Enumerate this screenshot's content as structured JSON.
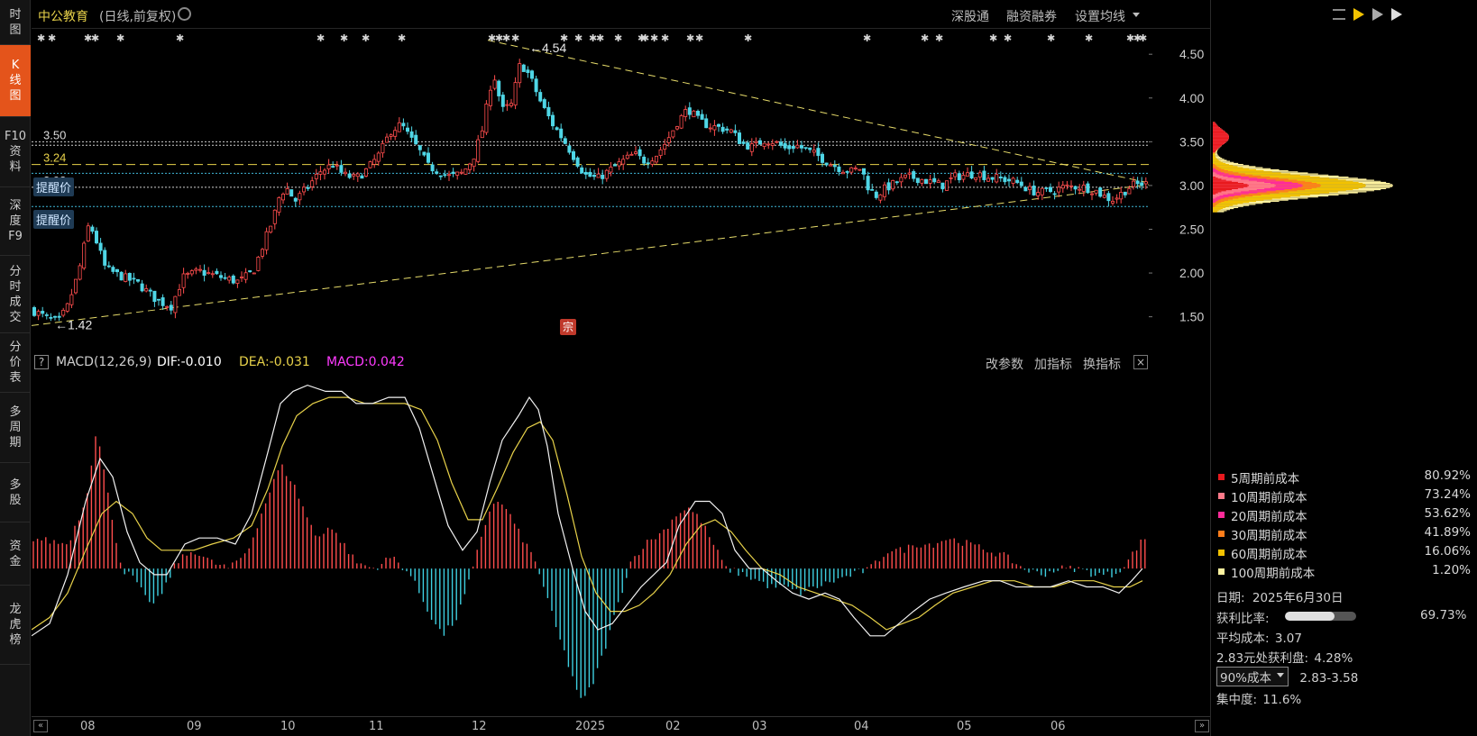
{
  "sidebar": {
    "items": [
      {
        "label": "时\n图",
        "active": false
      },
      {
        "label": "K\n线\n图",
        "active": true
      },
      {
        "label": "F10\n资\n料",
        "active": false
      },
      {
        "label": "深\n度\nF9",
        "active": false
      },
      {
        "label": "分\n时\n成\n交",
        "active": false
      },
      {
        "label": "分\n价\n表",
        "active": false
      },
      {
        "label": "多\n周\n期",
        "active": false
      },
      {
        "label": "多\n股",
        "active": false
      },
      {
        "label": "资\n金",
        "active": false
      },
      {
        "label": "龙\n虎\n榜",
        "active": false
      }
    ]
  },
  "header": {
    "stock_name": "中公教育",
    "chart_mode": "(日线,前复权)",
    "links": [
      "深股通",
      "融资融券",
      "设置均线"
    ]
  },
  "price_chart": {
    "y_ticks": [
      "4.50",
      "4.00",
      "3.50",
      "3.00",
      "2.50",
      "2.00",
      "1.50"
    ],
    "y_tick_values": [
      4.5,
      4.0,
      3.5,
      3.0,
      2.5,
      2.0,
      1.5
    ],
    "y_range": [
      1.28,
      4.78
    ],
    "high_label": "4.54",
    "low_label": "1.42",
    "level_labels": [
      "3.50",
      "3.24",
      "2.98"
    ],
    "reminder_labels": [
      "提醒价",
      "提醒价"
    ],
    "badge": "宗",
    "colors": {
      "up": "#ff4d4d",
      "down": "#4fd6e6",
      "trend": "#e6db6a",
      "level_white": "#cfcfcf",
      "level_cyan": "#3fb7d8",
      "level_yellow": "#e8d24a"
    }
  },
  "macd": {
    "title": "MACD(12,26,9)",
    "dif_label": "DIF:-0.010",
    "dea_label": "DEA:-0.031",
    "macd_label": "MACD:0.042",
    "links": [
      "改参数",
      "加指标",
      "换指标"
    ],
    "y_ticks": [
      "0.28",
      "0.22",
      "0.16",
      "0.10",
      "0.05",
      "-0.01",
      "-0.07",
      "-0.12",
      "-0.18",
      "-0.24"
    ],
    "y_tick_values": [
      0.28,
      0.22,
      0.16,
      0.1,
      0.05,
      -0.01,
      -0.07,
      -0.12,
      -0.18,
      -0.24
    ],
    "y_range": [
      -0.25,
      0.31
    ]
  },
  "time_axis": {
    "labels": [
      "08",
      "09",
      "10",
      "11",
      "12",
      "2025",
      "02",
      "03",
      "04",
      "05",
      "06"
    ]
  },
  "cost_distribution": {
    "rows": [
      {
        "name": "5周期前成本",
        "pct": "80.92%",
        "color": "#e8191e"
      },
      {
        "name": "10周期前成本",
        "pct": "73.24%",
        "color": "#ff7a8a"
      },
      {
        "name": "20周期前成本",
        "pct": "53.62%",
        "color": "#ff2b9a"
      },
      {
        "name": "30周期前成本",
        "pct": "41.89%",
        "color": "#ff7d1a"
      },
      {
        "name": "60周期前成本",
        "pct": "16.06%",
        "color": "#f2c200"
      },
      {
        "name": "100周期前成本",
        "pct": "1.20%",
        "color": "#fff3a0"
      }
    ],
    "date_label": "日期:",
    "date_value": "2025年6月30日",
    "profit_ratio_label": "获利比率:",
    "profit_ratio_value": "69.73%",
    "profit_ratio": 0.6973,
    "avg_cost_label": "平均成本:",
    "avg_cost_value": "3.07",
    "price_profit_label": "2.83元处获利盘:",
    "price_profit_value": "4.28%",
    "cost_select": "90%成本",
    "cost_range": "2.83-3.58",
    "concentration_label": "集中度:",
    "concentration_value": "11.6%"
  }
}
